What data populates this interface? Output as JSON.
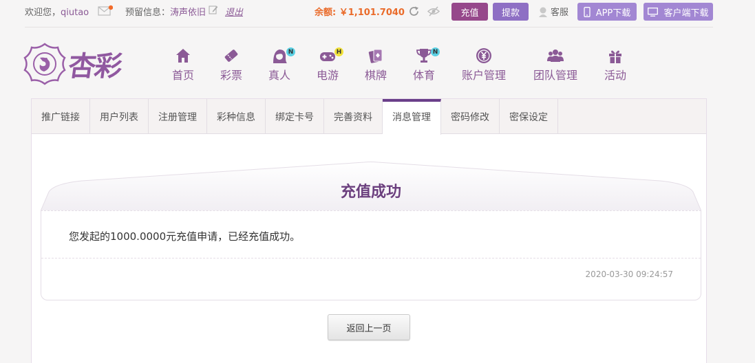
{
  "topbar": {
    "welcome": "欢迎您，",
    "username": "qiutao",
    "reserve_label": "预留信息：",
    "reserve_value": "涛声依旧",
    "logout": "退出",
    "balance": "余额: ￥1,101.7040",
    "recharge": "充值",
    "withdraw": "提款",
    "service": "客服",
    "app_download": "APP下载",
    "client_download": "客户端下载"
  },
  "logo": {
    "text": "杏彩"
  },
  "nav": [
    {
      "label": "首页",
      "icon": "home-icon"
    },
    {
      "label": "彩票",
      "icon": "lottery-ticket-icon"
    },
    {
      "label": "真人",
      "icon": "live-dealer-icon",
      "badge": "N"
    },
    {
      "label": "电游",
      "icon": "gamepad-icon",
      "badge": "H"
    },
    {
      "label": "棋牌",
      "icon": "playing-cards-icon"
    },
    {
      "label": "体育",
      "icon": "trophy-icon",
      "badge": "N"
    },
    {
      "label": "账户管理",
      "icon": "yen-coin-icon"
    },
    {
      "label": "团队管理",
      "icon": "team-icon"
    },
    {
      "label": "活动",
      "icon": "gift-icon"
    }
  ],
  "tabs": [
    {
      "label": "推广链接"
    },
    {
      "label": "用户列表"
    },
    {
      "label": "注册管理"
    },
    {
      "label": "彩种信息"
    },
    {
      "label": "绑定卡号"
    },
    {
      "label": "完善资料"
    },
    {
      "label": "消息管理",
      "active": true
    },
    {
      "label": "密码修改"
    },
    {
      "label": "密保设定"
    }
  ],
  "message": {
    "title": "充值成功",
    "body": "您发起的1000.0000元充值申请，已经充值成功。",
    "time": "2020-03-30 09:24:57"
  },
  "back_button": "返回上一页",
  "colors": {
    "brand": "#8b5a96",
    "recharge_btn": "#96488b",
    "withdraw_btn": "#8e6fc4",
    "download_btn": "#a287d3",
    "balance": "#ea6b2a"
  }
}
